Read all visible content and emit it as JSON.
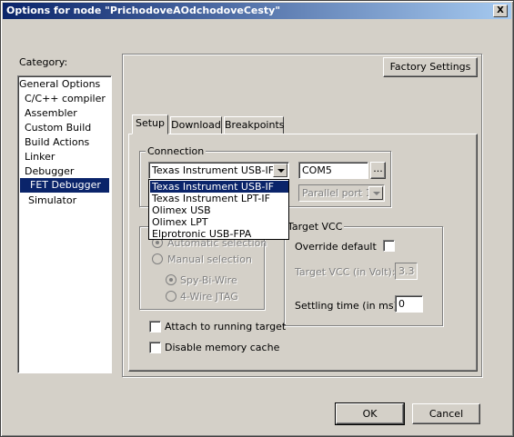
{
  "window": {
    "title": "Options for node \"PrichodoveAOdchodoveCesty\"",
    "close_glyph": "X"
  },
  "category": {
    "label": "Category:",
    "items": [
      {
        "label": "General Options"
      },
      {
        "label": "C/C++ compiler"
      },
      {
        "label": "Assembler"
      },
      {
        "label": "Custom Build"
      },
      {
        "label": "Build Actions"
      },
      {
        "label": "Linker"
      },
      {
        "label": "Debugger"
      },
      {
        "label": "FET Debugger",
        "selected": true
      },
      {
        "label": "Simulator"
      }
    ]
  },
  "factory_settings_label": "Factory Settings",
  "tabs": [
    {
      "label": "Setup",
      "active": true
    },
    {
      "label": "Download"
    },
    {
      "label": "Breakpoints"
    }
  ],
  "connection": {
    "title": "Connection",
    "selected": "Texas Instrument USB-IF",
    "port_value": "COM5",
    "browse_label": "...",
    "parallel_port": "Parallel port 1",
    "options": [
      "Texas Instrument USB-IF",
      "Texas Instrument LPT-IF",
      "Olimex USB",
      "Olimex LPT",
      "Elprotronic USB-FPA"
    ]
  },
  "selection": {
    "automatic": "Automatic selection",
    "manual": "Manual selection",
    "spy_bi_wire": "Spy-Bi-Wire",
    "four_wire": "4-Wire JTAG"
  },
  "target_vcc": {
    "title": "Target VCC",
    "override_label": "Override default",
    "vcc_label": "Target VCC (in Volt):",
    "vcc_value": "3.3",
    "settling_label": "Settling time (in ms):",
    "settling_value": "0"
  },
  "attach_label": "Attach to running target",
  "disable_cache_label": "Disable memory cache",
  "ok_label": "OK",
  "cancel_label": "Cancel"
}
